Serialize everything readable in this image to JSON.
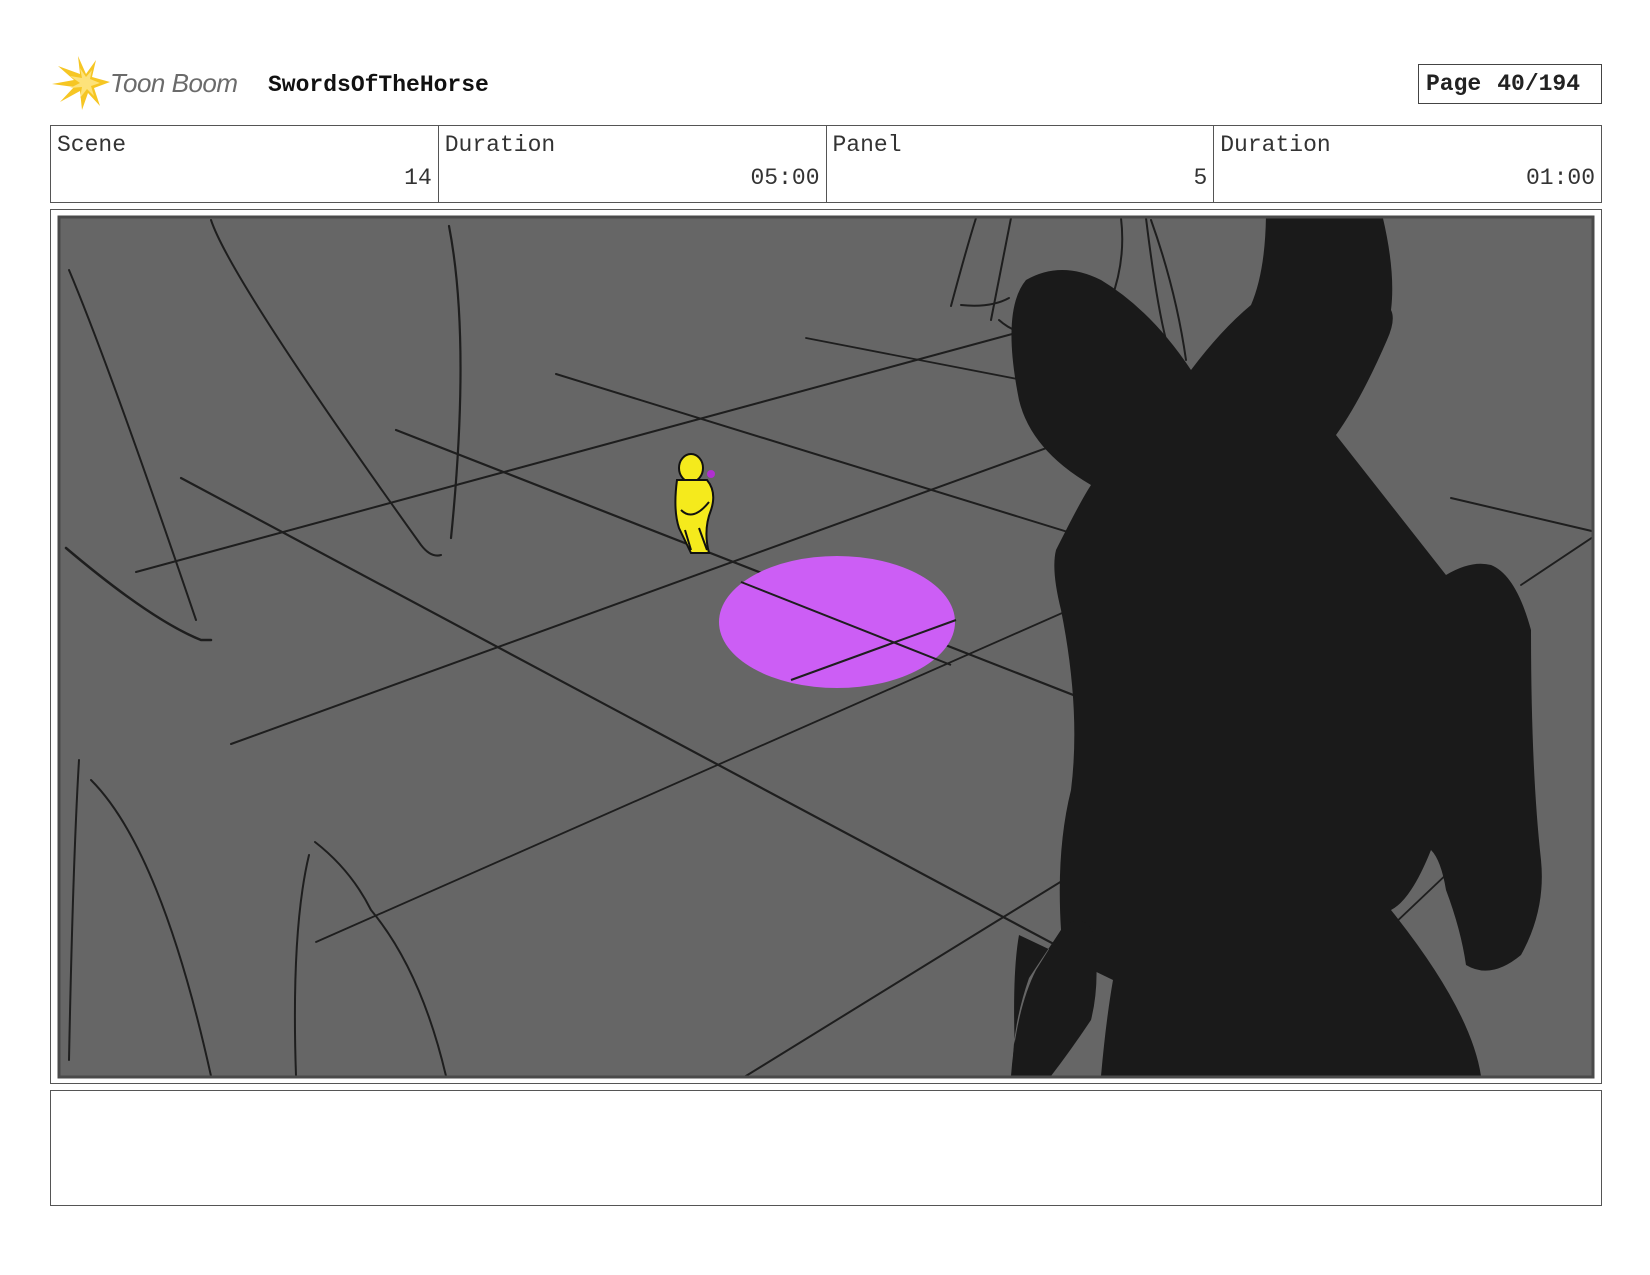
{
  "header": {
    "logo_text": "Toon Boom",
    "project_title": "SwordsOfTheHorse",
    "page_label": "Page",
    "page_value": "40/194"
  },
  "info": {
    "scene_label": "Scene",
    "scene_value": "14",
    "scene_duration_label": "Duration",
    "scene_duration_value": "05:00",
    "panel_label": "Panel",
    "panel_value": "5",
    "panel_duration_label": "Duration",
    "panel_duration_value": "01:00"
  },
  "colors": {
    "ground": "#666666",
    "silhouette": "#1a1a1a",
    "spotlight": "#cc5ef5",
    "figure": "#f5ea1c",
    "logo": "#f6c623"
  },
  "notes": {
    "text": ""
  }
}
